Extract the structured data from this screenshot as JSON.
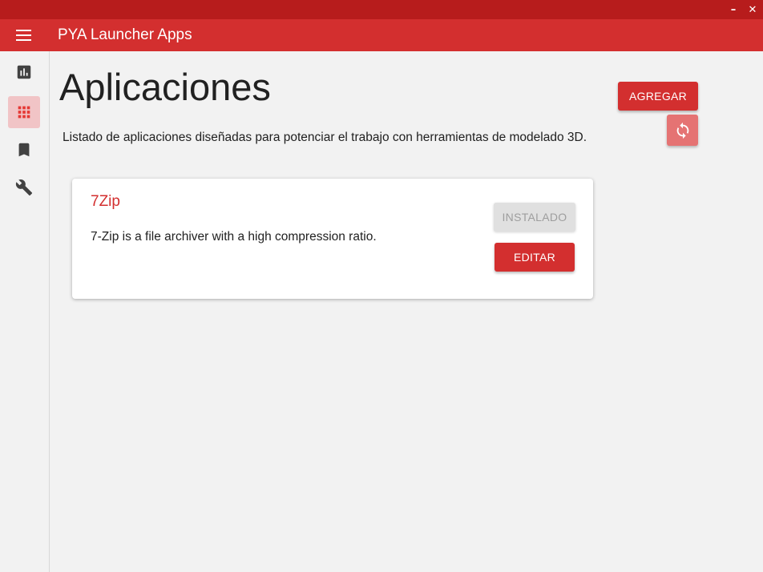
{
  "window": {
    "minimize_glyph": "–",
    "close_glyph": "✕",
    "titlebar_color": "#b71c1c"
  },
  "appbar": {
    "title": "PYA Launcher Apps",
    "menu_icon": "hamburger-menu-icon",
    "color": "#d32f2f"
  },
  "sidebar": {
    "items": [
      {
        "icon": "bar-chart-icon",
        "active": false
      },
      {
        "icon": "apps-grid-icon",
        "active": true
      },
      {
        "icon": "bookmark-icon",
        "active": false
      },
      {
        "icon": "wrench-icon",
        "active": false
      }
    ],
    "active_color": "#f1c4c6"
  },
  "page": {
    "title": "Aplicaciones",
    "description": "Listado de aplicaciones diseñadas para potenciar el trabajo con herramientas de modelado 3D.",
    "add_label": "AGREGAR",
    "refresh_icon": "sync-icon"
  },
  "apps": [
    {
      "name": "7Zip",
      "description": "7-Zip is a file archiver with a high compression ratio.",
      "status_label": "INSTALADO",
      "edit_label": "EDITAR"
    }
  ],
  "colors": {
    "accent": "#d32f2f",
    "accent_light": "#e57373",
    "disabled_bg": "#e0e0e0",
    "disabled_text": "#9e9e9e"
  }
}
